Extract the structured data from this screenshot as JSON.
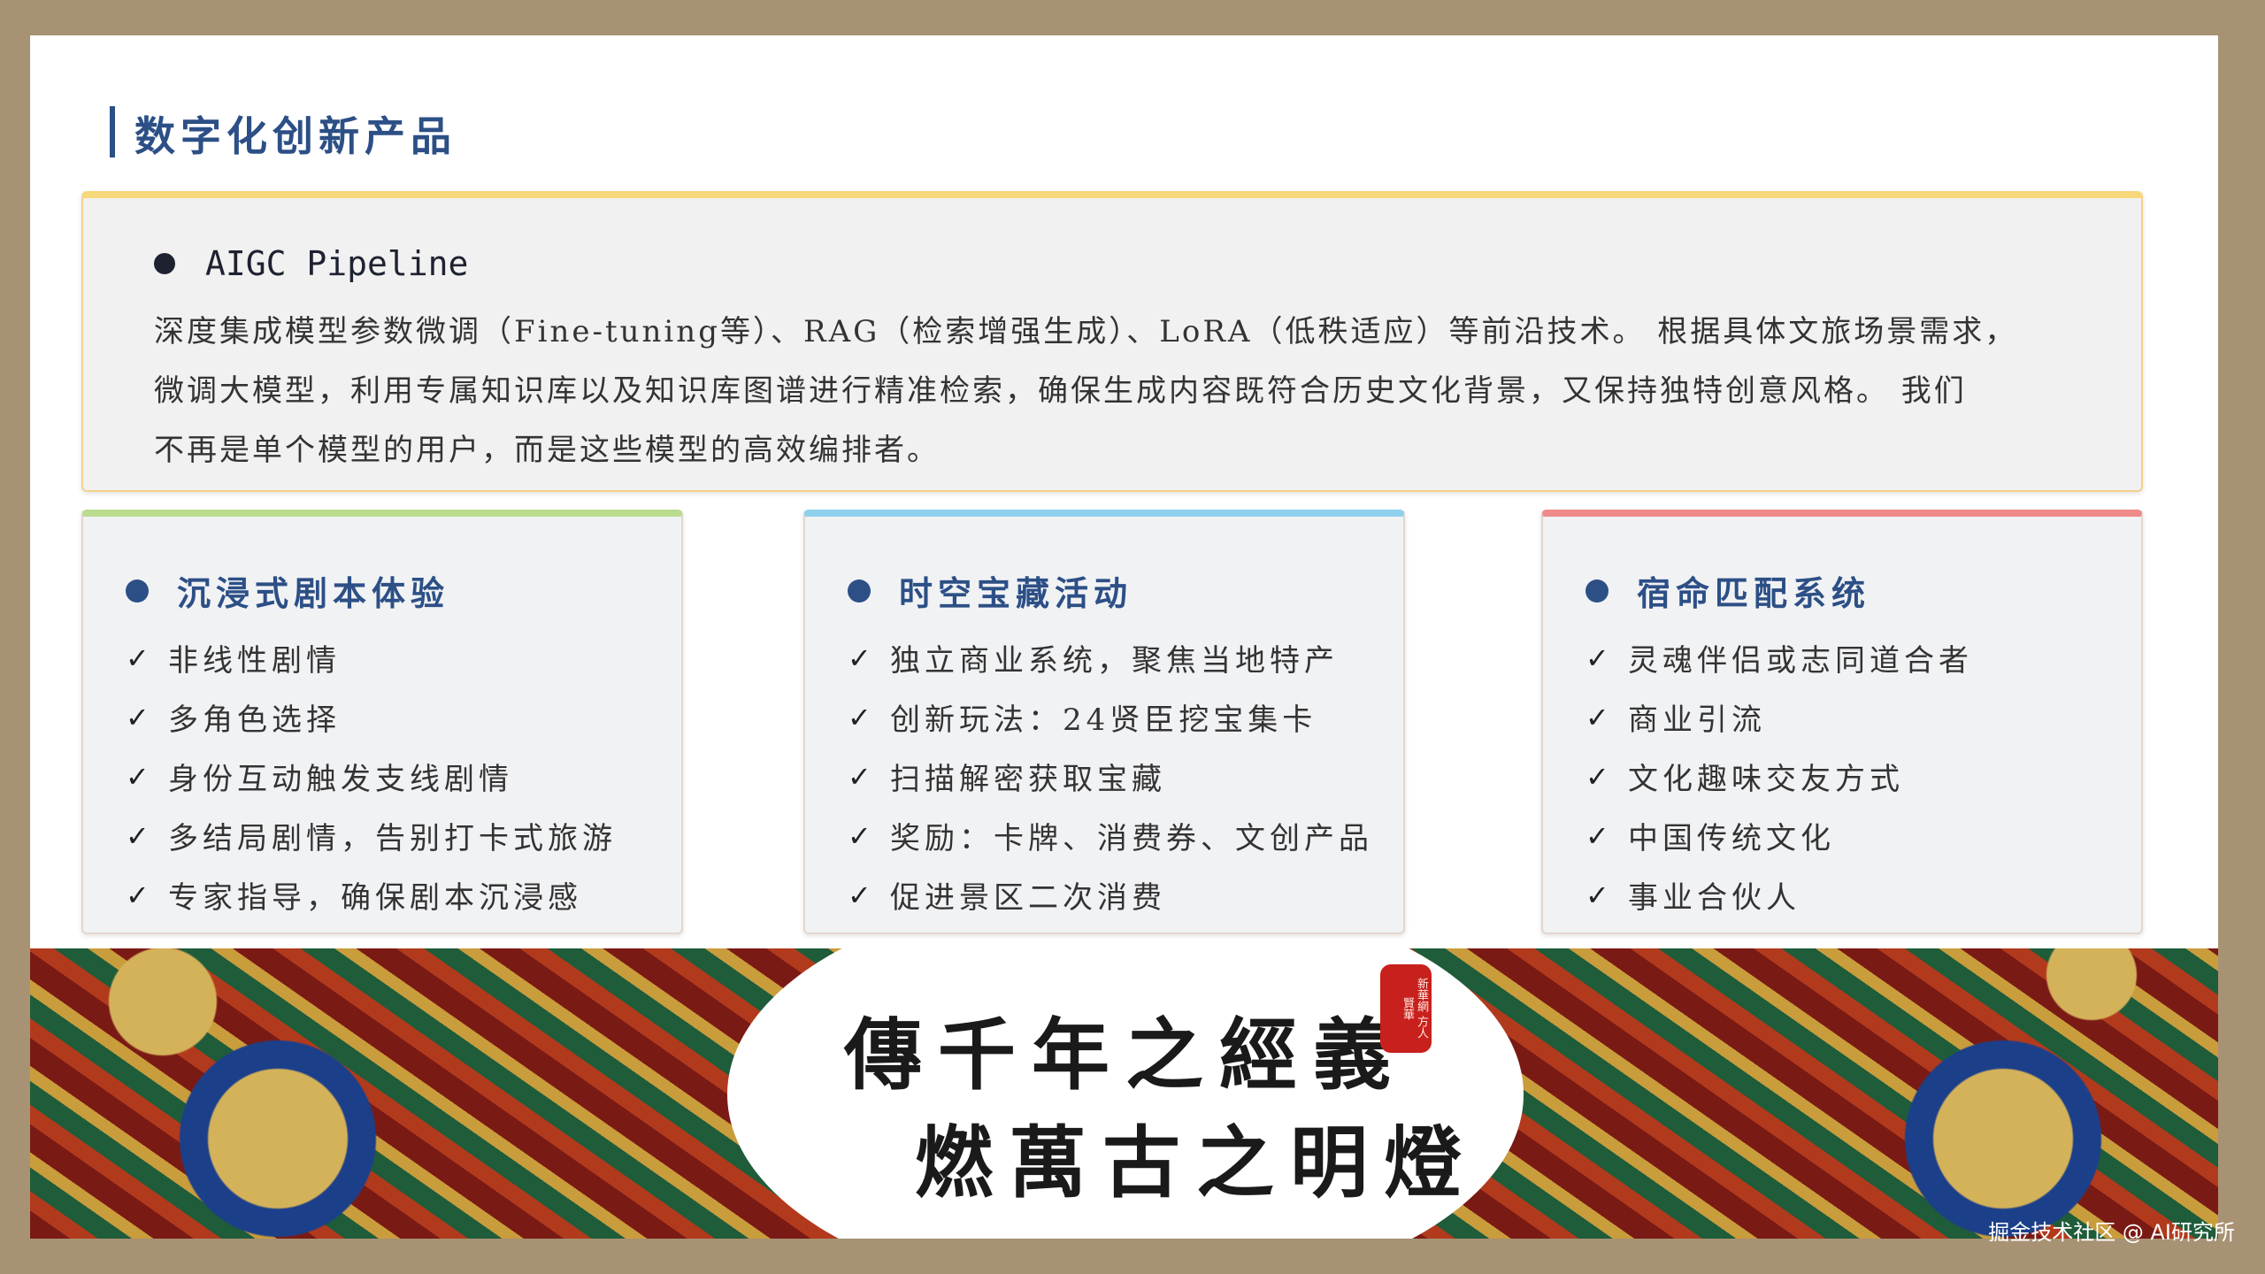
{
  "page": {
    "title": "数字化创新产品"
  },
  "top_card": {
    "heading": "AIGC Pipeline",
    "lines": [
      "深度集成模型参数微调（Fine-tuning等）、RAG（检索增强生成）、LoRA（低秩适应）等前沿技术。 根据具体文旅场景需求，",
      "微调大模型，利用专属知识库以及知识库图谱进行精准检索，确保生成内容既符合历史文化背景，又保持独特创意风格。 我们",
      "不再是单个模型的用户，而是这些模型的高效编排者。"
    ],
    "accent_color": "#f6d77a"
  },
  "cards": [
    {
      "heading": "沉浸式剧本体验",
      "accent_color": "#b9dc8e",
      "items": [
        "非线性剧情",
        "多角色选择",
        "身份互动触发支线剧情",
        "多结局剧情，告别打卡式旅游",
        "专家指导，确保剧本沉浸感"
      ]
    },
    {
      "heading": "时空宝藏活动",
      "accent_color": "#8fd0ec",
      "items": [
        "独立商业系统，聚焦当地特产",
        "创新玩法：24贤臣挖宝集卡",
        "扫描解密获取宝藏",
        "奖励：卡牌、消费券、文创产品",
        "促进景区二次消费"
      ]
    },
    {
      "heading": "宿命匹配系统",
      "accent_color": "#f08a8a",
      "items": [
        "灵魂伴侣或志同道合者",
        "商业引流",
        "文化趣味交友方式",
        "中国传统文化",
        "事业合伙人"
      ]
    }
  ],
  "banner": {
    "line1": "傳千年之經義",
    "line2": "燃萬古之明燈",
    "seal_text": "新華網 方人賢華"
  },
  "watermark": "掘金技术社区 @ AI研究所",
  "colors": {
    "heading_blue": "#2c4f86",
    "frame": "#a89274"
  }
}
